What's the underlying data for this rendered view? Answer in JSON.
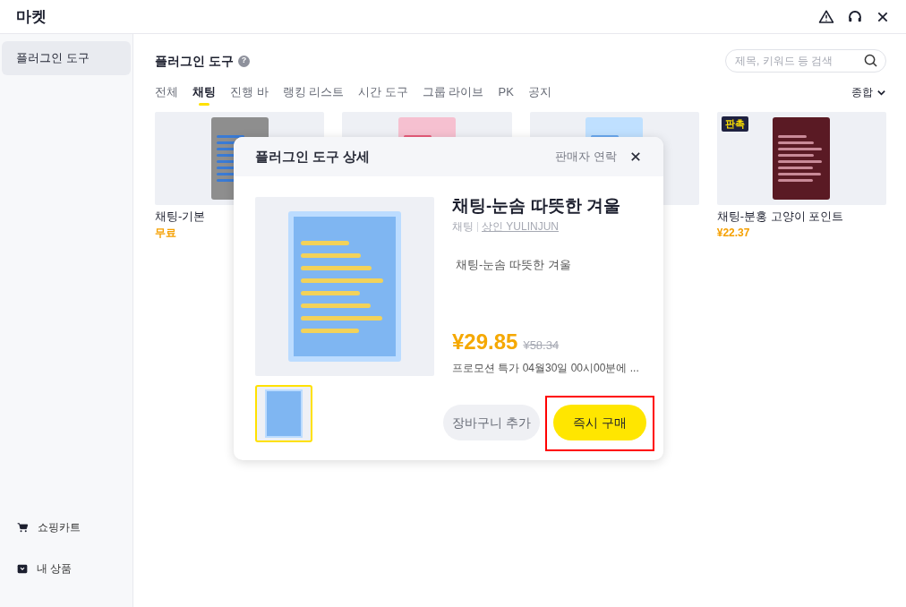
{
  "window": {
    "title": "마켓"
  },
  "sidebar": {
    "items": [
      {
        "label": "플러그인 도구",
        "selected": true
      }
    ],
    "bottom_items": [
      {
        "label": "쇼핑카트",
        "kind": "cart"
      },
      {
        "label": "내 상품",
        "kind": "box"
      }
    ]
  },
  "header": {
    "title": "플러그인 도구",
    "help": "?",
    "search": {
      "placeholder": "제목, 키워드 등 검색"
    }
  },
  "tabs": [
    {
      "label": "전체",
      "selected": false
    },
    {
      "label": "채팅",
      "selected": true
    },
    {
      "label": "진행 바",
      "selected": false
    },
    {
      "label": "랭킹 리스트",
      "selected": false
    },
    {
      "label": "시간 도구",
      "selected": false
    },
    {
      "label": "그룹 라이브",
      "selected": false
    },
    {
      "label": "PK",
      "selected": false
    },
    {
      "label": "공지",
      "selected": false
    }
  ],
  "sort": {
    "label": "종합"
  },
  "cards": [
    {
      "kind": "listing",
      "name": "채팅-기본",
      "price": "무료"
    },
    {
      "kind": "covered"
    },
    {
      "kind": "covered"
    },
    {
      "kind": "listing",
      "name": "채팅-분홍 고양이 포인트",
      "price": "¥22.37",
      "badge": "판촉"
    }
  ],
  "dialog": {
    "title": "플러그인 도구 상세",
    "contact": "판매자 연락",
    "product": {
      "name": "채팅-눈솜 따뜻한 겨울",
      "category": "채팅",
      "seller": "상인 YULINJUN",
      "description": "채팅-눈솜 따뜻한 겨울",
      "price": "¥29.85",
      "original_price": "¥58.34",
      "promo": "프로모션 특가 04월30일 00시00분에 ..."
    },
    "thumbnails": [
      {
        "selected": true
      }
    ],
    "buttons": [
      {
        "label": "장바구니 추가",
        "kind": "secondary",
        "highlighted": false
      },
      {
        "label": "즉시 구매",
        "kind": "primary",
        "highlighted": true
      }
    ]
  }
}
